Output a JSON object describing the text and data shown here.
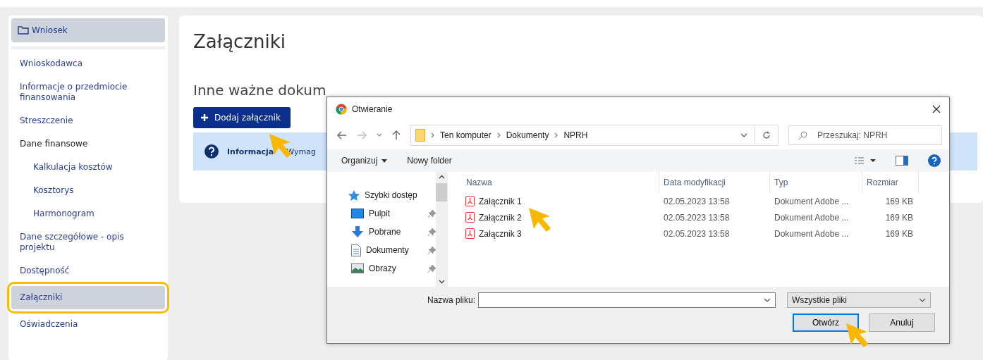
{
  "sidebar": {
    "header": "Wniosek",
    "items": [
      {
        "label": "Wnioskodawca",
        "selected": false
      },
      {
        "label": "Informacje o przedmiocie finansowania",
        "selected": false
      },
      {
        "label": "Streszczenie",
        "selected": false
      },
      {
        "label": "Dane finansowe",
        "selected": false,
        "children": [
          {
            "label": "Kalkulacja kosztów",
            "selected": false
          },
          {
            "label": "Kosztorys",
            "selected": false
          },
          {
            "label": "Harmonogram",
            "selected": false
          }
        ]
      },
      {
        "label": "Dane szczegółowe - opis projektu",
        "selected": false
      },
      {
        "label": "Dostępność",
        "selected": false
      },
      {
        "label": "Załączniki",
        "selected": true
      },
      {
        "label": "Oświadczenia",
        "selected": false
      }
    ]
  },
  "main": {
    "title": "Załączniki",
    "section_title": "Inne ważne dokum",
    "add_button": "Dodaj załącznik",
    "info": {
      "label": "Informacja",
      "text": "Wymag"
    }
  },
  "dialog": {
    "title": "Otwieranie",
    "breadcrumb": [
      "Ten komputer",
      "Dokumenty",
      "NPRH"
    ],
    "search": {
      "placeholder": "Przeszukaj: NPRH"
    },
    "toolbar": [
      "Organizuj",
      "Nowy folder"
    ],
    "nav": {
      "label": "Szybki dostęp",
      "children": [
        {
          "label": "Pulpit",
          "kind": "desktop"
        },
        {
          "label": "Pobrane",
          "kind": "download"
        },
        {
          "label": "Dokumenty",
          "kind": "document"
        },
        {
          "label": "Obrazy",
          "kind": "image"
        }
      ]
    },
    "columns": [
      "Nazwa",
      "Data modyfikacji",
      "Typ",
      "Rozmiar"
    ],
    "files": [
      {
        "name": "Załącznik 1",
        "modified": "02.05.2023 13:58",
        "type": "Dokument Adobe ...",
        "size": "169 KB",
        "selected": false
      },
      {
        "name": "Załącznik 2",
        "modified": "02.05.2023 13:58",
        "type": "Dokument Adobe ...",
        "size": "169 KB",
        "selected": false
      },
      {
        "name": "Załącznik 3",
        "modified": "02.05.2023 13:58",
        "type": "Dokument Adobe ...",
        "size": "169 KB",
        "selected": false
      }
    ],
    "filename_label": "Nazwa pliku:",
    "filter": "Wszystkie pliki",
    "buttons": [
      "Otwórz",
      "Anuluj"
    ]
  }
}
